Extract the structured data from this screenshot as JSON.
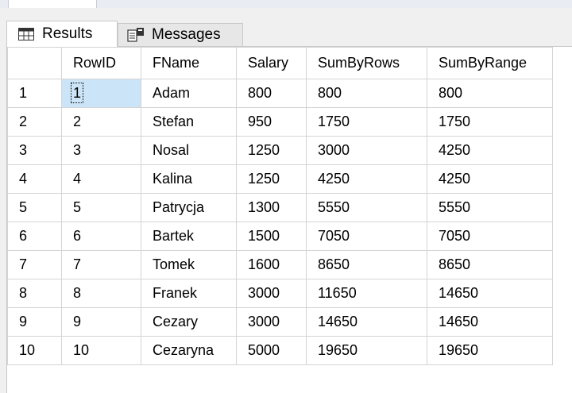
{
  "tabs": [
    {
      "label": "Results",
      "icon": "grid-icon"
    },
    {
      "label": "Messages",
      "icon": "messages-icon"
    }
  ],
  "grid": {
    "columns": [
      "",
      "RowID",
      "FName",
      "Salary",
      "SumByRows",
      "SumByRange"
    ],
    "rows": [
      [
        "1",
        "1",
        "Adam",
        "800",
        "800",
        "800"
      ],
      [
        "2",
        "2",
        "Stefan",
        "950",
        "1750",
        "1750"
      ],
      [
        "3",
        "3",
        "Nosal",
        "1250",
        "3000",
        "4250"
      ],
      [
        "4",
        "4",
        "Kalina",
        "1250",
        "4250",
        "4250"
      ],
      [
        "5",
        "5",
        "Patrycja",
        "1300",
        "5550",
        "5550"
      ],
      [
        "6",
        "6",
        "Bartek",
        "1500",
        "7050",
        "7050"
      ],
      [
        "7",
        "7",
        "Tomek",
        "1600",
        "8650",
        "8650"
      ],
      [
        "8",
        "8",
        "Franek",
        "3000",
        "11650",
        "14650"
      ],
      [
        "9",
        "9",
        "Cezary",
        "3000",
        "14650",
        "14650"
      ],
      [
        "10",
        "10",
        "Cezaryna",
        "5000",
        "19650",
        "19650"
      ]
    ]
  }
}
